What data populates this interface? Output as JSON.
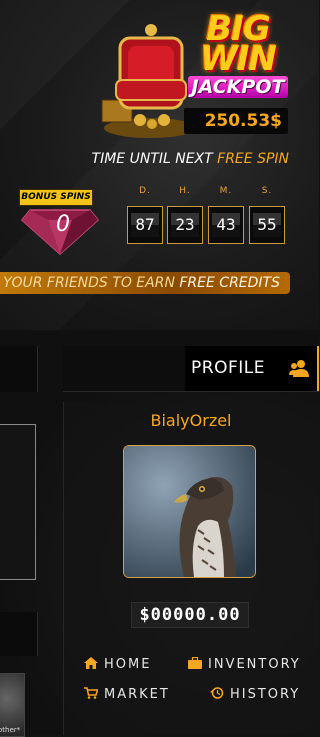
{
  "jackpot": {
    "logo_big_win": "BIG\nWIN",
    "logo_jackpot": "JACKPOT",
    "amount": "250.53$"
  },
  "free_spin": {
    "label_prefix": "TIME UNTIL NEXT ",
    "label_highlight": "FREE SPIN",
    "bonus_badge": "BONUS SPINS",
    "bonus_count": "0",
    "countdown": [
      {
        "unit": "D.",
        "value": "87"
      },
      {
        "unit": "H.",
        "value": "23"
      },
      {
        "unit": "M.",
        "value": "43"
      },
      {
        "unit": "S.",
        "value": "55"
      }
    ]
  },
  "invite": {
    "prefix": "TE YOUR ",
    "middle": "FRIENDS TO EARN ",
    "highlight": "FREE CREDITS"
  },
  "profile": {
    "title": "PROFILE",
    "username": "BialyOrzel",
    "balance": "$00000.00"
  },
  "menu": {
    "home": "HOME",
    "inventory": "INVENTORY",
    "market": "MARKET",
    "history": "HISTORY"
  },
  "left_column": {
    "avatar_caption": "other*"
  },
  "colors": {
    "accent": "#f6a623",
    "jackpot_gold": "#ffcc1a",
    "jackpot_pink": "#ff4ad6",
    "banner_orange": "#c17a0b"
  },
  "icons": {
    "profile": "user-group-icon",
    "home": "home-icon",
    "inventory": "briefcase-icon",
    "market": "cart-icon",
    "history": "history-icon",
    "bonus": "gem-icon"
  }
}
